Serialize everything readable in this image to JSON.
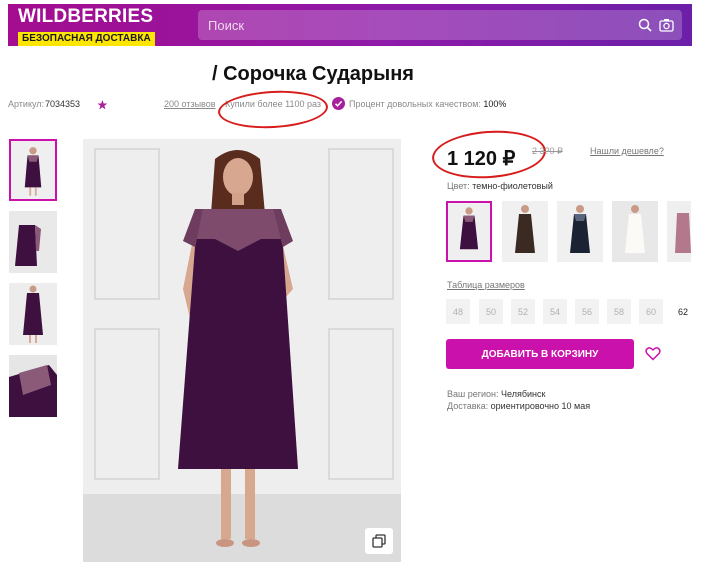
{
  "header": {
    "logo": "WILDBERRIES",
    "logo_tagline": "БЕЗОПАСНАЯ ДОСТАВКА",
    "search_placeholder": "Поиск"
  },
  "product": {
    "title": "/ Сорочка Сударыня",
    "article_label": "Артикул:",
    "article": "7034353",
    "rating_stars": 5,
    "reviews": "200 отзывов",
    "bought": "Купили более 1100 раз",
    "quality_label": "Процент довольных качеством:",
    "quality_value": "100%",
    "price": "1 120 ₽",
    "old_price": "2 3?0 ₽",
    "cheaper_link": "Нашли дешевле?",
    "color_label": "Цвет:",
    "color_value": "темно-фиолетовый",
    "size_table_label": "Таблица размеров",
    "sizes": [
      "48",
      "50",
      "52",
      "54",
      "56",
      "58",
      "60",
      "62"
    ],
    "available_size": "62",
    "add_to_cart": "ДОБАВИТЬ В КОРЗИНУ",
    "region_label": "Ваш регион:",
    "region_value": "Челябинск",
    "delivery_label": "Доставка:",
    "delivery_value": "ориентировочно 10 мая"
  },
  "colors": {
    "accent": "#cb11ab",
    "header_gradient_start": "#a40d8f",
    "header_gradient_end": "#6b1fa8",
    "logo_tag_bg": "#ffe600",
    "annotation": "#d81b1b",
    "dress_purple": "#3d1040"
  },
  "icons": [
    "search-icon",
    "camera-icon",
    "check-icon",
    "heart-icon",
    "copy-icon",
    "star-icon"
  ]
}
